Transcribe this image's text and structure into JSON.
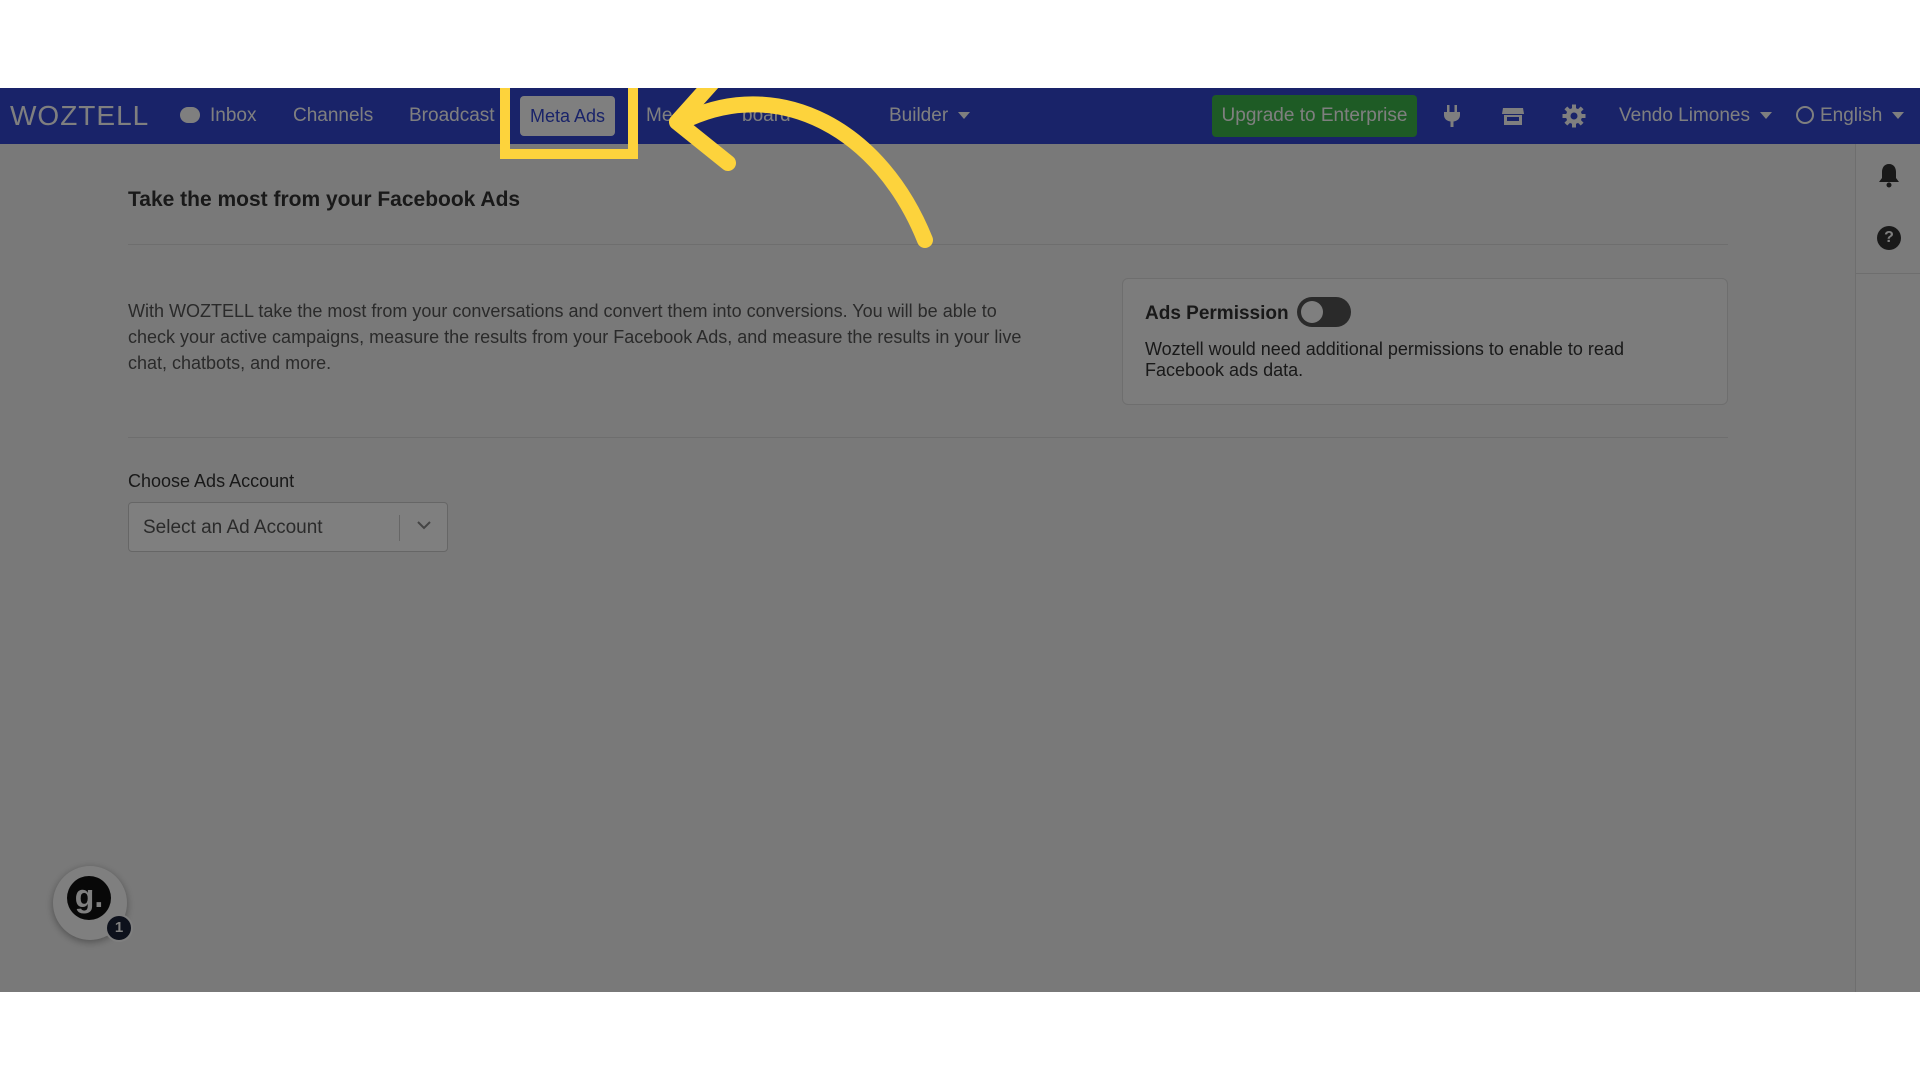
{
  "navbar": {
    "logo": "WOZTELL",
    "items": [
      {
        "label": "Inbox"
      },
      {
        "label": "Channels"
      },
      {
        "label": "Broadcast"
      },
      {
        "label": "Meta Ads"
      },
      {
        "label": "Me"
      },
      {
        "label": "board"
      },
      {
        "label": "Builder"
      }
    ],
    "upgrade_label": "Upgrade to Enterprise",
    "user_label": "Vendo Limones",
    "language_label": "English",
    "bar_color": "#3246d3",
    "upgrade_color": "#3cb64a"
  },
  "main": {
    "title": "Take the most from your Facebook Ads",
    "intro": "With WOZTELL take the most from your conversations and convert them into conversions. You will be able to check your active campaigns, measure the results from your Facebook Ads, and measure the results in your live chat, chatbots, and more.",
    "permission": {
      "title": "Ads Permission",
      "enabled": false,
      "description": "Woztell would need additional permissions to enable to read Facebook ads data."
    },
    "account": {
      "label": "Choose Ads Account",
      "placeholder": "Select an Ad Account"
    }
  },
  "right_rail": {
    "help_glyph": "?"
  },
  "guide_widget": {
    "glyph": "g.",
    "badge_count": "1"
  },
  "annotation": {
    "highlight_color": "#fdd33c"
  }
}
